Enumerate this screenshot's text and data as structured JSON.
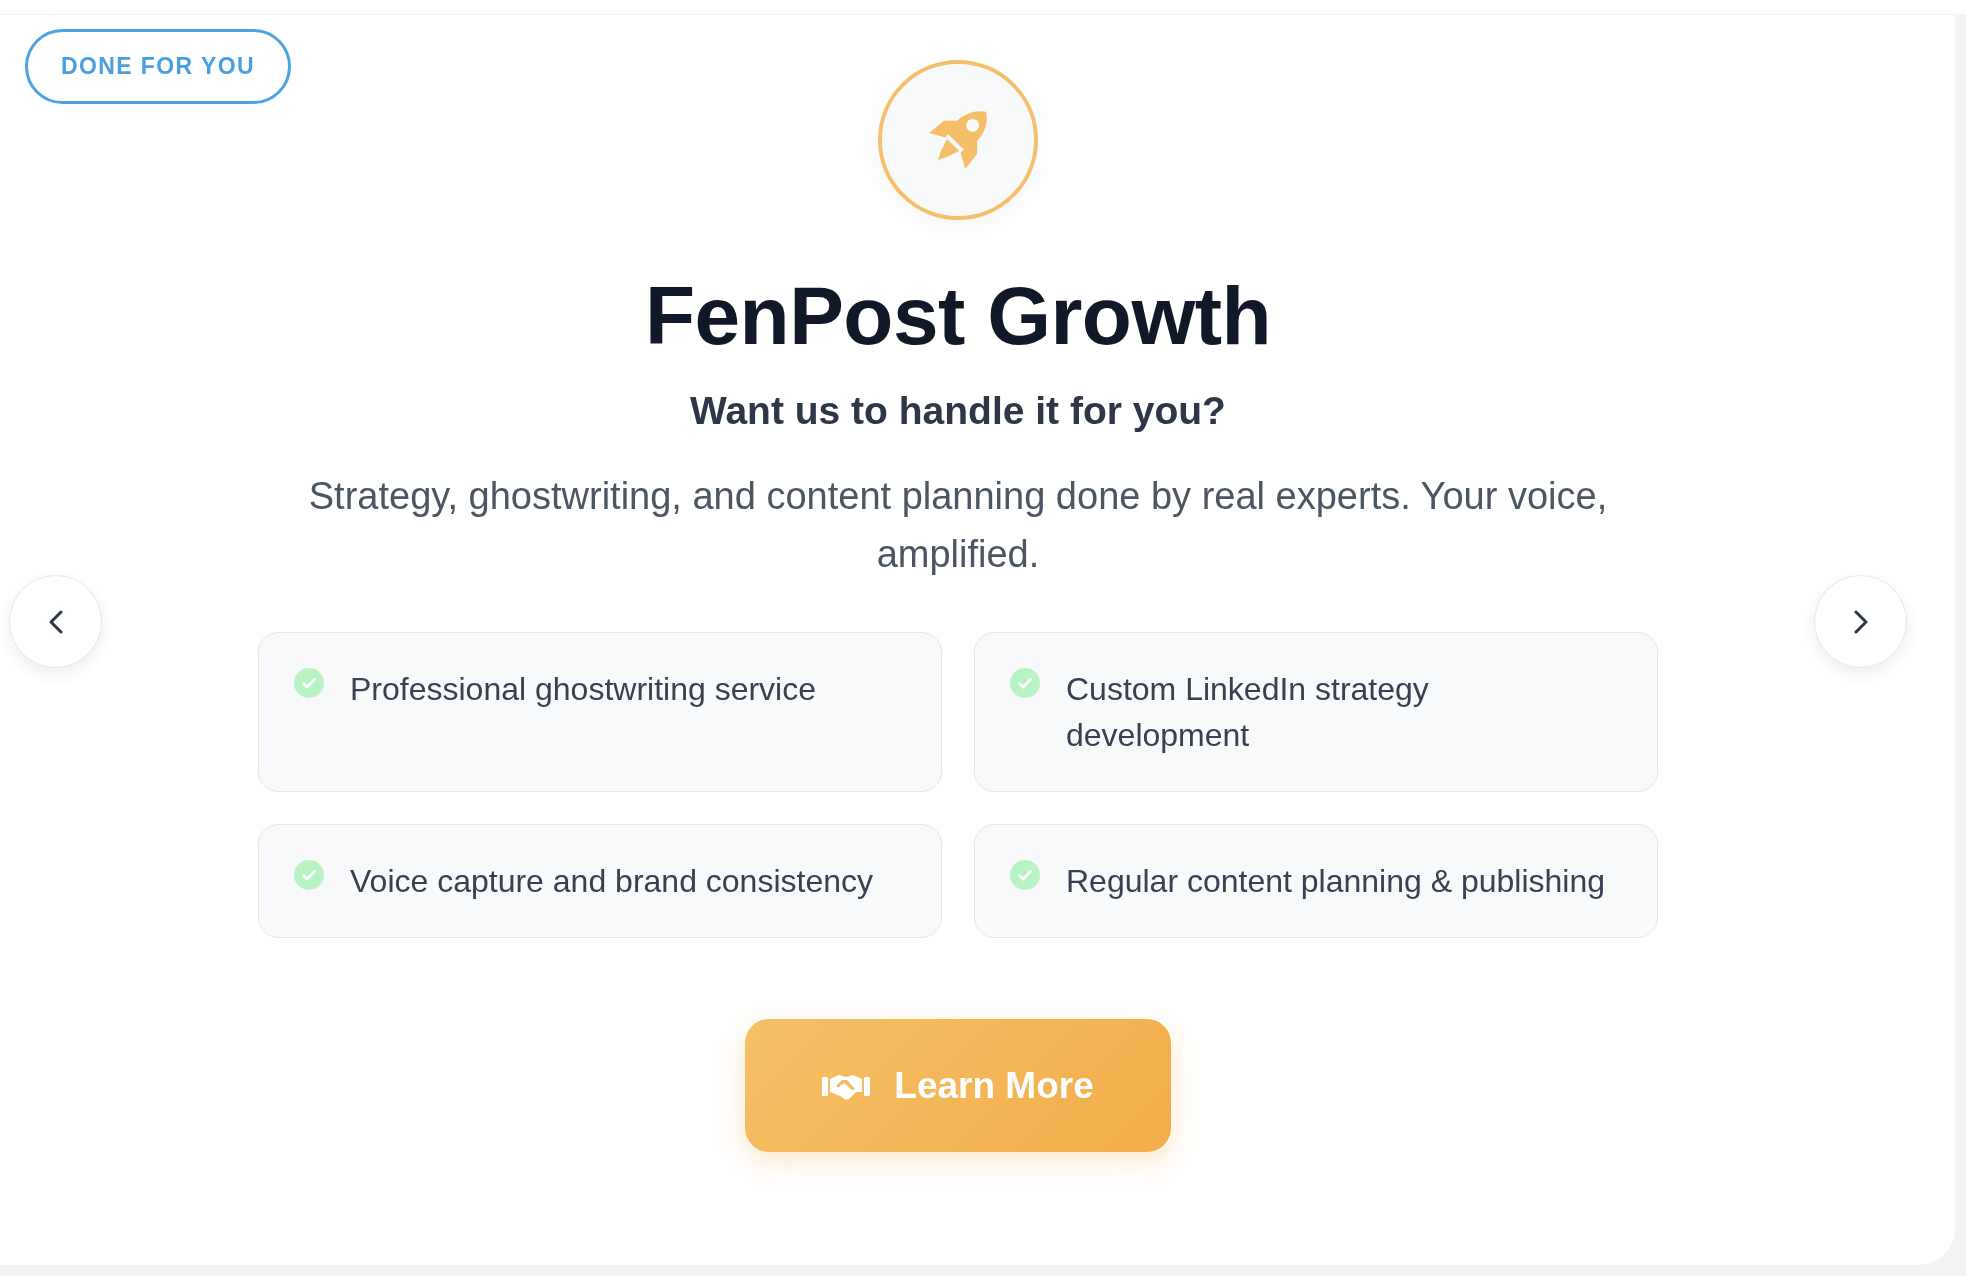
{
  "badge": {
    "label": "DONE FOR YOU"
  },
  "hero": {
    "title": "FenPost Growth",
    "subtitle": "Want us to handle it for you?",
    "description": "Strategy, ghostwriting, and content planning done by real experts. Your voice, amplified."
  },
  "features": [
    "Professional ghostwriting service",
    "Custom LinkedIn strategy development",
    "Voice capture and brand consistency",
    "Regular content planning & publishing"
  ],
  "cta": {
    "label": "Learn More"
  }
}
